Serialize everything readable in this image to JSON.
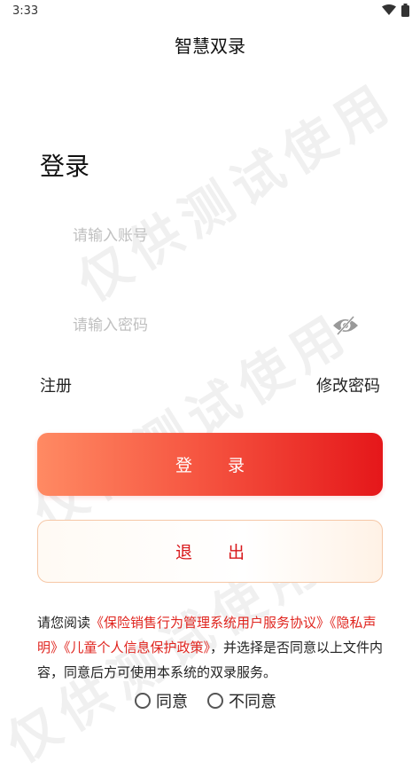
{
  "status_bar": {
    "time": "3:33"
  },
  "app_title": "智慧双录",
  "watermark": "仅供测试使用",
  "login": {
    "heading": "登录",
    "account_placeholder": "请输入账号",
    "password_placeholder": "请输入密码",
    "register_label": "注册",
    "change_password_label": "修改密码",
    "login_button": "登录",
    "exit_button": "退出"
  },
  "agreement": {
    "prefix": "请您阅读",
    "links": [
      "《保险销售行为管理系统用户服务协议》",
      "《隐私声明》",
      "《儿童个人信息保护政策》"
    ],
    "suffix": "，并选择是否同意以上文件内容，同意后方可使用本系统的双录服务。",
    "agree_label": "同意",
    "disagree_label": "不同意"
  },
  "colors": {
    "accent": "#e5171a",
    "link": "#e0251f"
  }
}
